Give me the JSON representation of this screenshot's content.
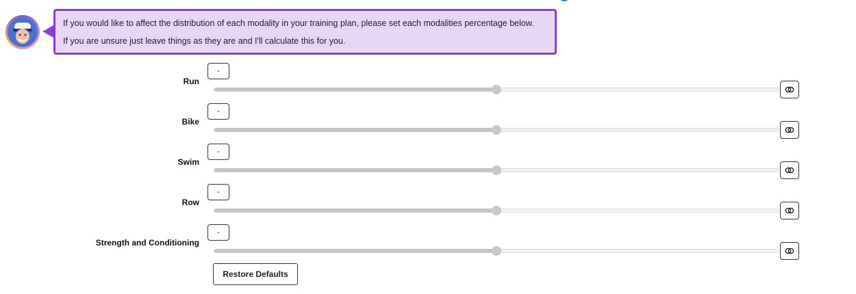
{
  "message": {
    "line1": "If you would like to affect the distribution of each modality in your training plan, please set each modalities percentage below.",
    "line2": "If you are unsure just leave things as they are and I'll calculate this for you."
  },
  "modalities": [
    {
      "label": "Run",
      "value_text": "-",
      "slider_fraction": 0.5,
      "lock_icon": "link-toggle-icon"
    },
    {
      "label": "Bike",
      "value_text": "-",
      "slider_fraction": 0.5,
      "lock_icon": "link-toggle-icon"
    },
    {
      "label": "Swim",
      "value_text": "-",
      "slider_fraction": 0.5,
      "lock_icon": "link-toggle-icon"
    },
    {
      "label": "Row",
      "value_text": "-",
      "slider_fraction": 0.5,
      "lock_icon": "link-toggle-icon"
    },
    {
      "label": "Strength and Conditioning",
      "value_text": "-",
      "slider_fraction": 0.5,
      "lock_icon": "link-toggle-icon"
    }
  ],
  "actions": {
    "restore_label": "Restore Defaults"
  },
  "colors": {
    "bubble_bg": "#e8d6f7",
    "bubble_border": "#8b3fd9",
    "slider_fill": "#c4c4c4",
    "slider_track": "#f1f1f1"
  }
}
